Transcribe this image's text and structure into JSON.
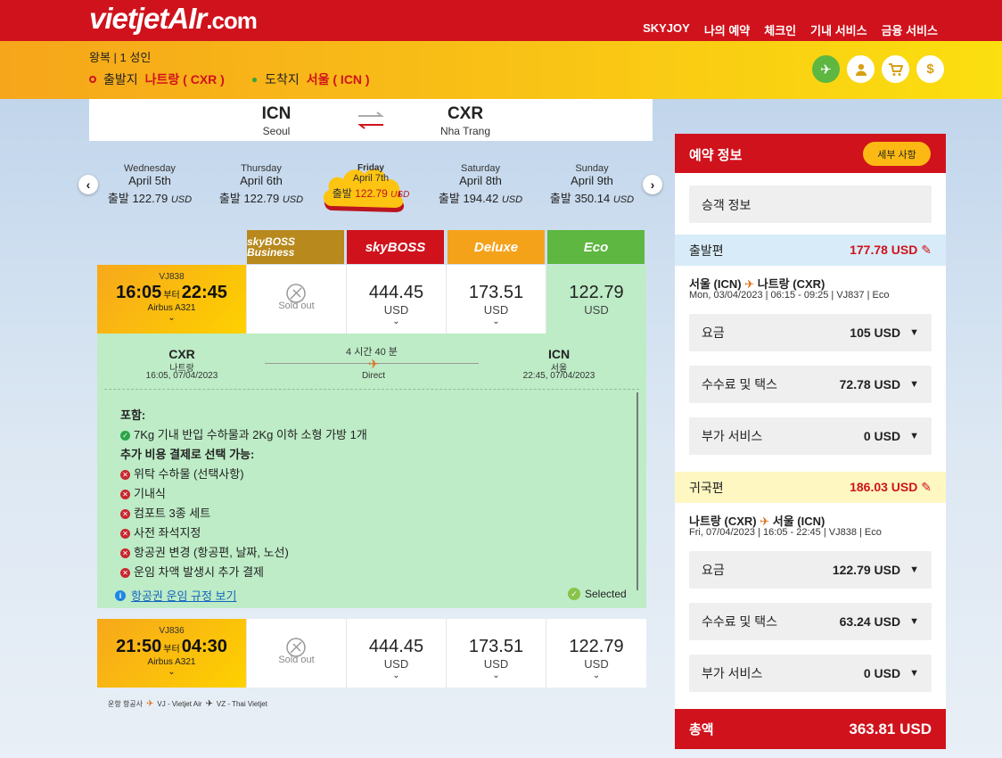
{
  "header": {
    "logo_main": "vietjet",
    "logo_air": "AIr",
    "logo_dotcom": ".com",
    "nav": [
      "SKYJOY",
      "나의 예약",
      "체크인",
      "기내 서비스",
      "금융 서비스"
    ]
  },
  "subbar": {
    "trip_type": "왕복 | 1 성인",
    "origin_label": "출발지",
    "origin_value": "나트랑 ( CXR )",
    "dest_label": "도착지",
    "dest_value": "서울 ( ICN )",
    "icons": [
      "plane-icon",
      "user-icon",
      "cart-icon",
      "dollar-icon"
    ]
  },
  "route": {
    "from_code": "ICN",
    "from_city": "Seoul",
    "to_code": "CXR",
    "to_city": "Nha Trang"
  },
  "dates": [
    {
      "weekday": "Wednesday",
      "date": "April 5th",
      "prefix": "출발",
      "price": "122.79",
      "cur": "USD"
    },
    {
      "weekday": "Thursday",
      "date": "April 6th",
      "prefix": "출발",
      "price": "122.79",
      "cur": "USD"
    },
    {
      "weekday": "Friday",
      "date": "April 7th",
      "prefix": "출발",
      "price": "122.79",
      "cur": "USD",
      "selected": true
    },
    {
      "weekday": "Saturday",
      "date": "April 8th",
      "prefix": "출발",
      "price": "194.42",
      "cur": "USD"
    },
    {
      "weekday": "Sunday",
      "date": "April 9th",
      "prefix": "출발",
      "price": "350.14",
      "cur": "USD"
    }
  ],
  "fare_classes": [
    {
      "name": "skyBOSS Business",
      "color": "#b8891d"
    },
    {
      "name": "skyBOSS",
      "color": "#d0121c"
    },
    {
      "name": "Deluxe",
      "color": "#f5a21b"
    },
    {
      "name": "Eco",
      "color": "#5db740"
    }
  ],
  "flights": [
    {
      "flight_no": "VJ838",
      "depart": "16:05",
      "connector": "부터",
      "arrive": "22:45",
      "aircraft": "Airbus A321",
      "sold_out": "Sold out",
      "prices": [
        {
          "v": "444.45",
          "c": "USD"
        },
        {
          "v": "173.51",
          "c": "USD"
        },
        {
          "v": "122.79",
          "c": "USD"
        }
      ]
    },
    {
      "flight_no": "VJ836",
      "depart": "21:50",
      "connector": "부터",
      "arrive": "04:30",
      "aircraft": "Airbus A321",
      "sold_out": "Sold out",
      "prices": [
        {
          "v": "444.45",
          "c": "USD"
        },
        {
          "v": "173.51",
          "c": "USD"
        },
        {
          "v": "122.79",
          "c": "USD"
        }
      ]
    }
  ],
  "flight_detail": {
    "from_code": "CXR",
    "from_city": "나트랑",
    "from_time": "16:05, 07/04/2023",
    "duration": "4 시간 40 분",
    "stops": "Direct",
    "to_code": "ICN",
    "to_city": "서울",
    "to_time": "22:45, 07/04/2023",
    "included_title": "포함:",
    "included": [
      "7Kg 기내 반입 수하물과 2Kg 이하 소형 가방 1개"
    ],
    "extra_title": "추가 비용 결제로 선택 가능:",
    "extras": [
      "위탁 수하물 (선택사항)",
      "기내식",
      "컴포트 3종 세트",
      "사전 좌석지정",
      "항공권 변경 (항공편, 날짜, 노선)",
      "운임 차액 발생시 추가 결제"
    ],
    "rules_link": "항공권 운임 규정 보기",
    "selected_label": "Selected"
  },
  "operating": {
    "label": "운항 항공사",
    "vj": "VJ - Vietjet Air",
    "vz": "VZ - Thai Vietjet"
  },
  "booking": {
    "title": "예약 정보",
    "details_button": "세부 사항",
    "passenger_info": "승객 정보",
    "outbound": {
      "label": "출발편",
      "amount": "177.78 USD",
      "route_from": "서울 (ICN)",
      "route_to": "나트랑 (CXR)",
      "info": "Mon, 03/04/2023 | 06:15 - 09:25 | VJ837 | Eco",
      "fees": [
        {
          "label": "요금",
          "value": "105 USD"
        },
        {
          "label": "수수료 및 택스",
          "value": "72.78 USD"
        },
        {
          "label": "부가 서비스",
          "value": "0 USD"
        }
      ]
    },
    "inbound": {
      "label": "귀국편",
      "amount": "186.03 USD",
      "route_from": "나트랑 (CXR)",
      "route_to": "서울 (ICN)",
      "info": "Fri, 07/04/2023 | 16:05 - 22:45 | VJ838 | Eco",
      "fees": [
        {
          "label": "요금",
          "value": "122.79 USD"
        },
        {
          "label": "수수료 및 택스",
          "value": "63.24 USD"
        },
        {
          "label": "부가 서비스",
          "value": "0 USD"
        }
      ]
    },
    "total_label": "총액",
    "total_value": "363.81 USD"
  }
}
